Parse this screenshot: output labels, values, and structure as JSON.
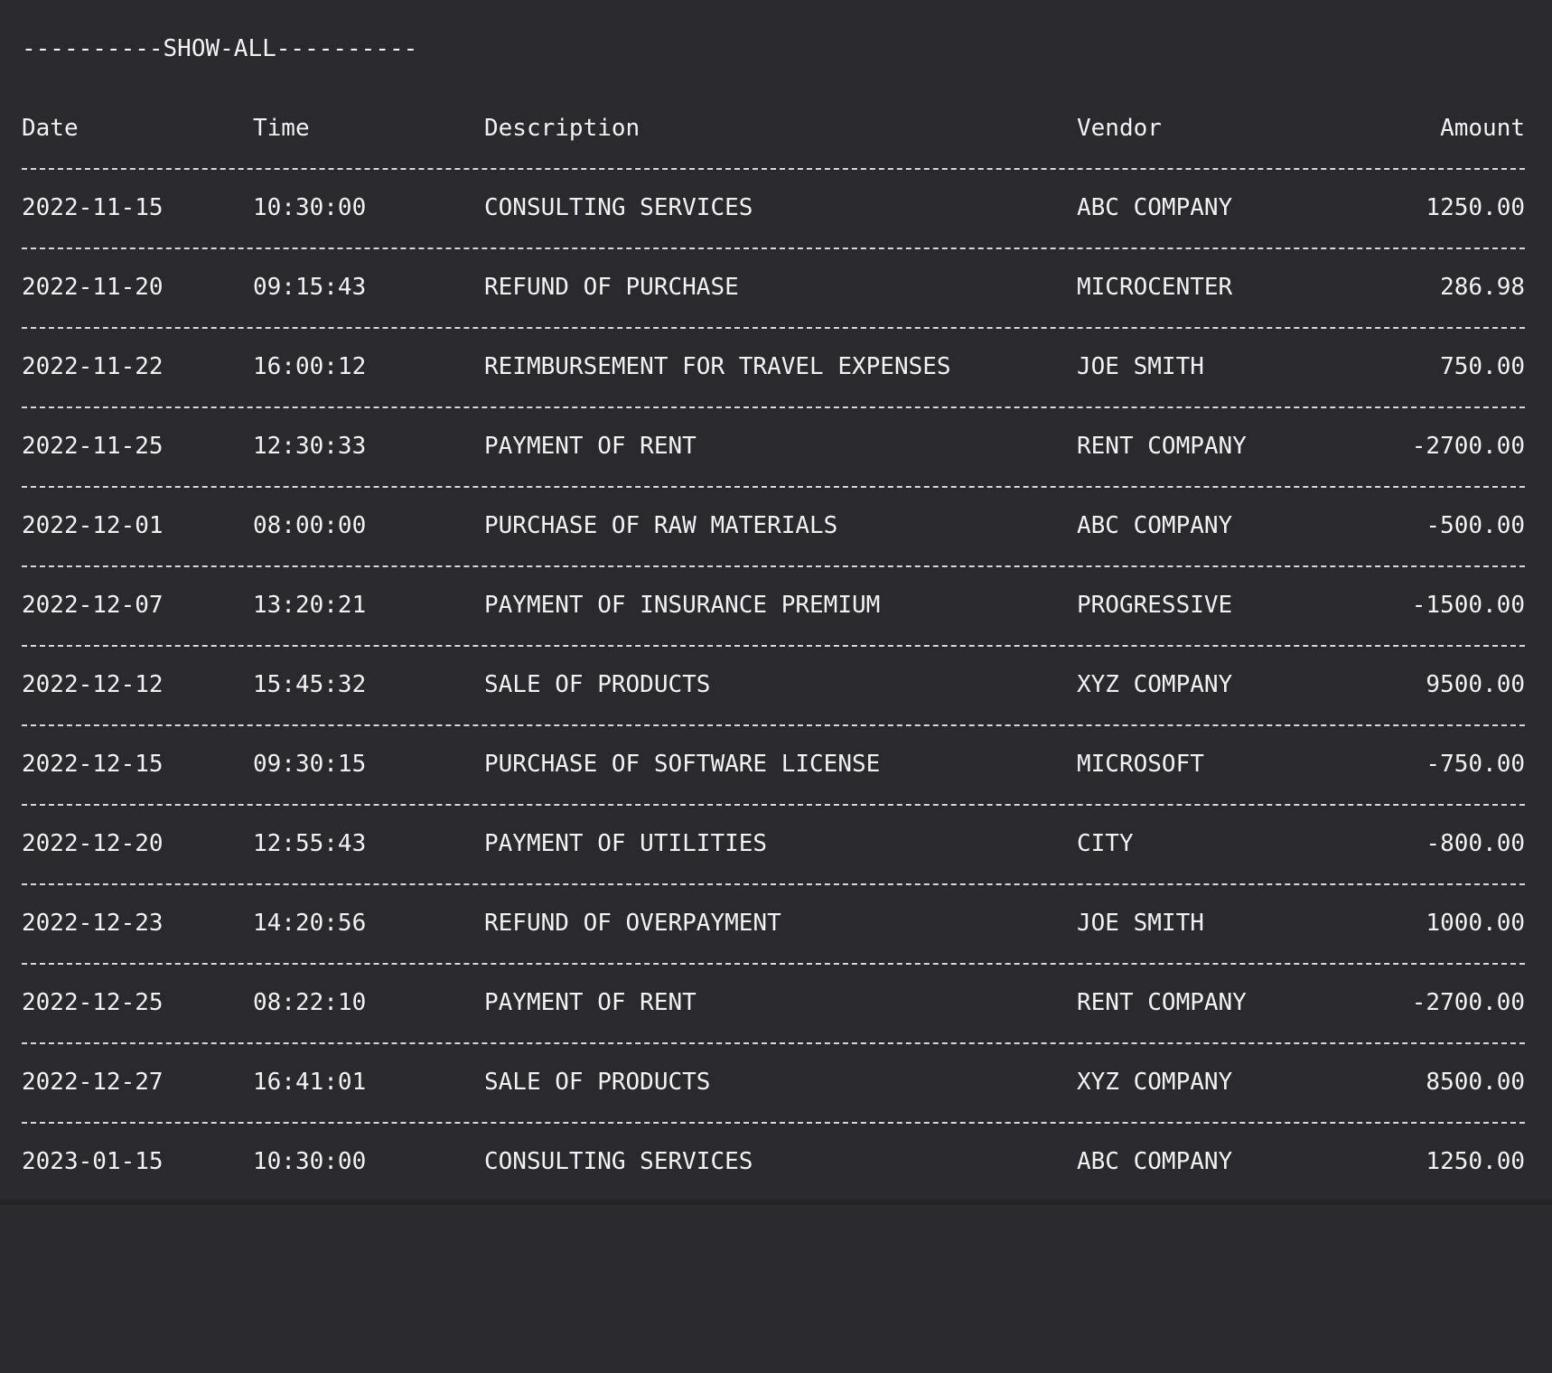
{
  "banner": "----------SHOW-ALL----------",
  "columns": {
    "date": "Date",
    "time": "Time",
    "description": "Description",
    "vendor": "Vendor",
    "amount": "Amount"
  },
  "rows": [
    {
      "date": "2022-11-15",
      "time": "10:30:00",
      "description": "CONSULTING SERVICES",
      "vendor": "ABC COMPANY",
      "amount": "1250.00"
    },
    {
      "date": "2022-11-20",
      "time": "09:15:43",
      "description": "REFUND OF PURCHASE",
      "vendor": "MICROCENTER",
      "amount": "286.98"
    },
    {
      "date": "2022-11-22",
      "time": "16:00:12",
      "description": "REIMBURSEMENT FOR TRAVEL EXPENSES",
      "vendor": "JOE SMITH",
      "amount": "750.00"
    },
    {
      "date": "2022-11-25",
      "time": "12:30:33",
      "description": "PAYMENT OF RENT",
      "vendor": "RENT COMPANY",
      "amount": "-2700.00"
    },
    {
      "date": "2022-12-01",
      "time": "08:00:00",
      "description": "PURCHASE OF RAW MATERIALS",
      "vendor": "ABC COMPANY",
      "amount": "-500.00"
    },
    {
      "date": "2022-12-07",
      "time": "13:20:21",
      "description": "PAYMENT OF INSURANCE PREMIUM",
      "vendor": "PROGRESSIVE",
      "amount": "-1500.00"
    },
    {
      "date": "2022-12-12",
      "time": "15:45:32",
      "description": "SALE OF PRODUCTS",
      "vendor": "XYZ COMPANY",
      "amount": "9500.00"
    },
    {
      "date": "2022-12-15",
      "time": "09:30:15",
      "description": "PURCHASE OF SOFTWARE LICENSE",
      "vendor": "MICROSOFT",
      "amount": "-750.00"
    },
    {
      "date": "2022-12-20",
      "time": "12:55:43",
      "description": "PAYMENT OF UTILITIES",
      "vendor": "CITY",
      "amount": "-800.00"
    },
    {
      "date": "2022-12-23",
      "time": "14:20:56",
      "description": "REFUND OF OVERPAYMENT",
      "vendor": "JOE SMITH",
      "amount": "1000.00"
    },
    {
      "date": "2022-12-25",
      "time": "08:22:10",
      "description": "PAYMENT OF RENT",
      "vendor": "RENT COMPANY",
      "amount": "-2700.00"
    },
    {
      "date": "2022-12-27",
      "time": "16:41:01",
      "description": "SALE OF PRODUCTS",
      "vendor": "XYZ COMPANY",
      "amount": "8500.00"
    },
    {
      "date": "2023-01-15",
      "time": "10:30:00",
      "description": "CONSULTING SERVICES",
      "vendor": "ABC COMPANY",
      "amount": "1250.00"
    }
  ]
}
